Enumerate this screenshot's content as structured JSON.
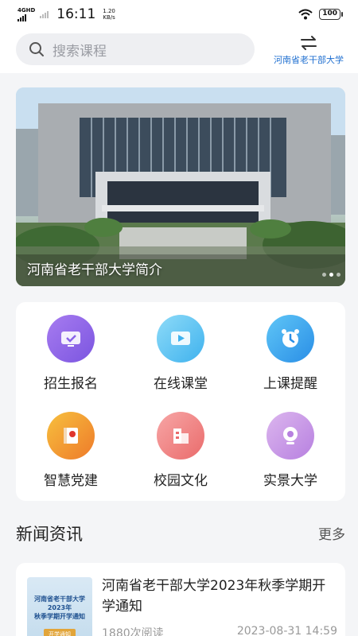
{
  "status_bar": {
    "network": "4G",
    "network_sup": "HD",
    "time": "16:11",
    "speed_value": "1.20",
    "speed_unit": "KB/s",
    "battery": "100"
  },
  "header": {
    "search_placeholder": "搜索课程",
    "switch_label": "河南省老干部大学"
  },
  "banner": {
    "caption": "河南省老干部大学简介",
    "slide_count": 3,
    "active_slide": 2
  },
  "features": [
    {
      "label": "招生报名",
      "icon": "monitor-check-icon",
      "color_from": "#a77cf0",
      "color_to": "#7b55e0"
    },
    {
      "label": "在线课堂",
      "icon": "play-screen-icon",
      "color_from": "#8edbf8",
      "color_to": "#3fb2ee"
    },
    {
      "label": "上课提醒",
      "icon": "alarm-clock-icon",
      "color_from": "#5fc6f7",
      "color_to": "#2a8ee6"
    },
    {
      "label": "智慧党建",
      "icon": "party-book-icon",
      "color_from": "#f7c03e",
      "color_to": "#ee7a2a"
    },
    {
      "label": "校园文化",
      "icon": "campus-building-icon",
      "color_from": "#f7a6a6",
      "color_to": "#ea6b6b"
    },
    {
      "label": "实景大学",
      "icon": "camera-view-icon",
      "color_from": "#dcb6ee",
      "color_to": "#b780e0"
    }
  ],
  "news": {
    "section_title": "新闻资讯",
    "more_label": "更多",
    "items": [
      {
        "title": "河南省老干部大学2023年秋季学期开学通知",
        "reads": "1880次阅读",
        "date": "2023-08-31 14:59",
        "thumb_line1": "河南省老干部大学2023年",
        "thumb_line2": "秋季学期开学通知",
        "thumb_button": "开学通知"
      }
    ]
  }
}
